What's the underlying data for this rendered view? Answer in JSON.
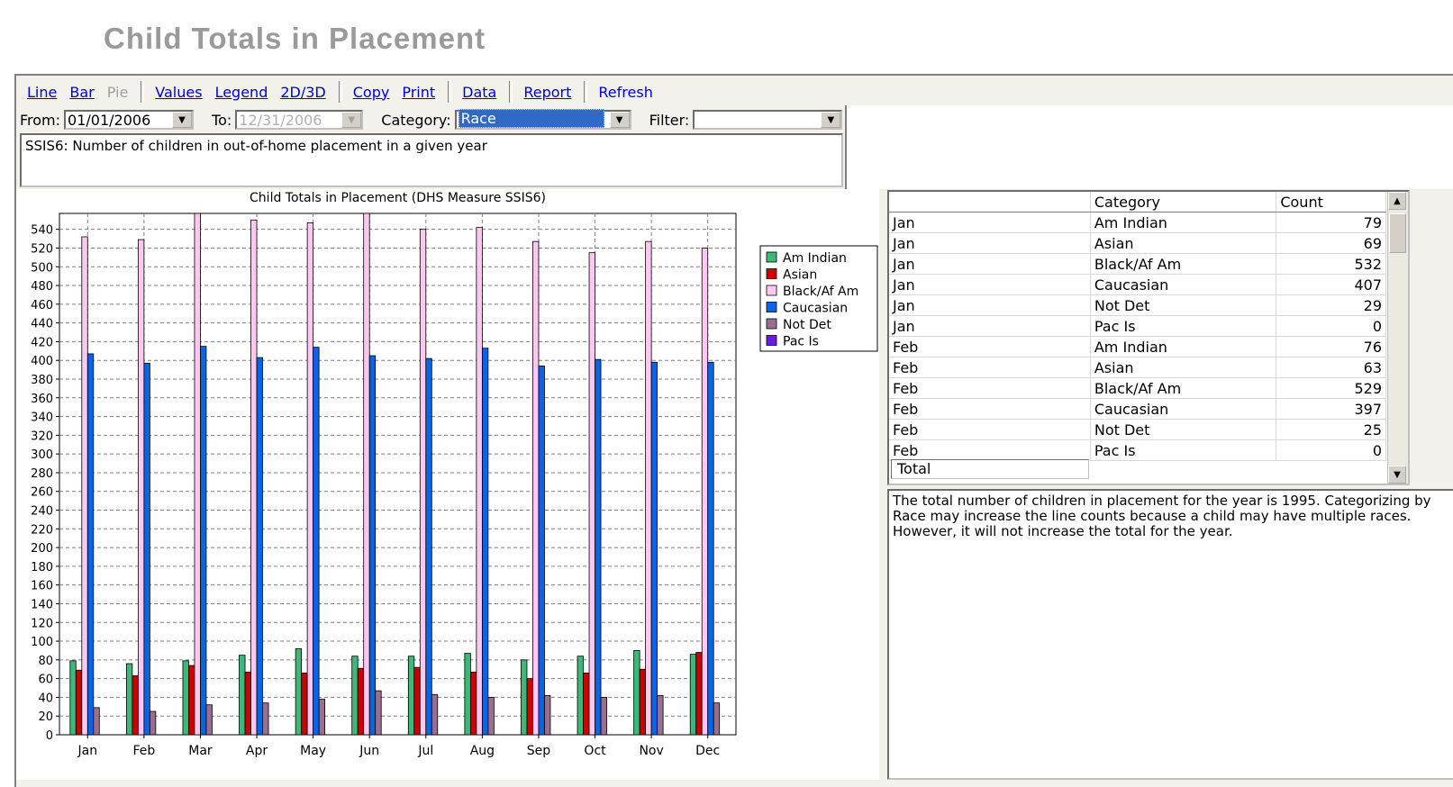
{
  "page": {
    "title": "Child Totals in Placement",
    "toolbar": {
      "line": "Line",
      "bar": "Bar",
      "pie": "Pie",
      "values": "Values",
      "legend": "Legend",
      "dim": "2D/3D",
      "copy": "Copy",
      "print": "Print",
      "data": "Data",
      "report": "Report",
      "refresh": "Refresh"
    },
    "filters": {
      "from_label": "From:",
      "from_value": "01/01/2006",
      "to_label": "To:",
      "to_value": "12/31/2006",
      "category_label": "Category:",
      "category_value": "Race",
      "filter_label": "Filter:",
      "filter_value": ""
    },
    "description": "SSIS6: Number of children in out-of-home placement in a given year",
    "grid": {
      "headers": [
        "",
        "Category",
        "Count"
      ],
      "rows": [
        [
          "Jan",
          "Am Indian",
          "79"
        ],
        [
          "Jan",
          "Asian",
          "69"
        ],
        [
          "Jan",
          "Black/Af Am",
          "532"
        ],
        [
          "Jan",
          "Caucasian",
          "407"
        ],
        [
          "Jan",
          "Not Det",
          "29"
        ],
        [
          "Jan",
          "Pac Is",
          "0"
        ],
        [
          "Feb",
          "Am Indian",
          "76"
        ],
        [
          "Feb",
          "Asian",
          "63"
        ],
        [
          "Feb",
          "Black/Af Am",
          "529"
        ],
        [
          "Feb",
          "Caucasian",
          "397"
        ],
        [
          "Feb",
          "Not Det",
          "25"
        ],
        [
          "Feb",
          "Pac Is",
          "0"
        ]
      ],
      "total_label": "Total"
    },
    "note": "The total number of children in placement for the year is 1995. Categorizing by Race may increase the line counts because a child may have multiple races.  However, it will not increase the total for the year."
  },
  "chart_data": {
    "type": "bar",
    "title": "Child Totals in Placement (DHS Measure SSIS6)",
    "categories": [
      "Jan",
      "Feb",
      "Mar",
      "Apr",
      "May",
      "Jun",
      "Jul",
      "Aug",
      "Sep",
      "Oct",
      "Nov",
      "Dec"
    ],
    "ylim": [
      0,
      557
    ],
    "yticks": [
      0,
      20,
      40,
      60,
      80,
      100,
      120,
      140,
      160,
      180,
      200,
      220,
      240,
      260,
      280,
      300,
      320,
      340,
      360,
      380,
      400,
      420,
      440,
      460,
      480,
      500,
      520,
      540
    ],
    "grid": true,
    "legend_position": "right",
    "series": [
      {
        "name": "Am Indian",
        "color": "#3cb878",
        "values": [
          79,
          76,
          79,
          85,
          92,
          84,
          84,
          87,
          80,
          84,
          90,
          86
        ]
      },
      {
        "name": "Asian",
        "color": "#cc0000",
        "values": [
          69,
          63,
          74,
          67,
          66,
          71,
          72,
          67,
          60,
          66,
          70,
          88
        ]
      },
      {
        "name": "Black/Af Am",
        "color": "#ffc8f0",
        "values": [
          532,
          529,
          557,
          550,
          547,
          557,
          540,
          542,
          527,
          515,
          527,
          520
        ]
      },
      {
        "name": "Caucasian",
        "color": "#0a64e6",
        "values": [
          407,
          397,
          415,
          403,
          414,
          405,
          402,
          413,
          394,
          401,
          398,
          398
        ]
      },
      {
        "name": "Not Det",
        "color": "#9a6e8e",
        "values": [
          29,
          25,
          32,
          34,
          38,
          47,
          43,
          40,
          42,
          40,
          42,
          34
        ]
      },
      {
        "name": "Pac Is",
        "color": "#6a1ae8",
        "values": [
          0,
          0,
          0,
          0,
          0,
          0,
          0,
          0,
          0,
          0,
          0,
          0
        ]
      }
    ]
  }
}
